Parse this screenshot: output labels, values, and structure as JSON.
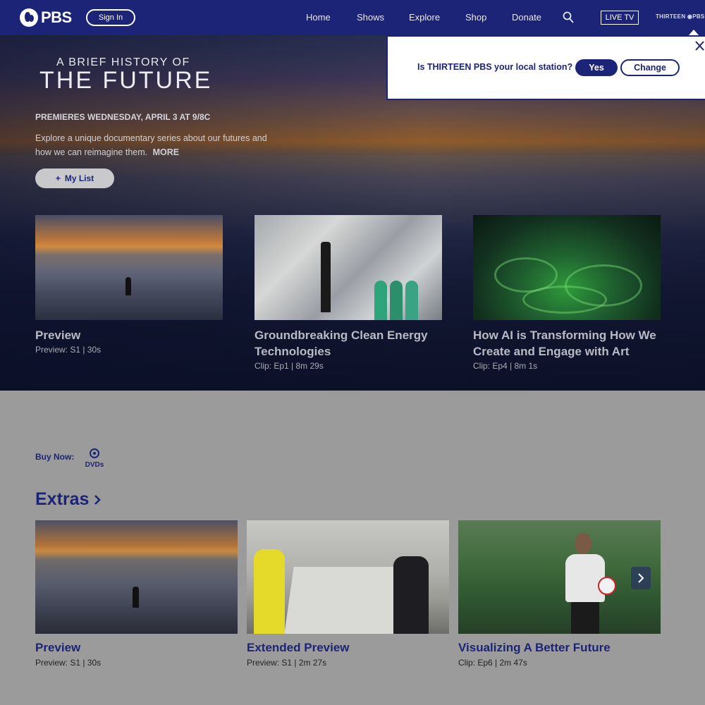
{
  "header": {
    "logo_text": "PBS",
    "signin_label": "Sign In",
    "nav": [
      "Home",
      "Shows",
      "Explore",
      "Shop",
      "Donate"
    ],
    "live_label": "LIVE TV",
    "station_logo_text": "THIRTEEN ◉PBS"
  },
  "hero": {
    "title_line1": "A BRIEF HISTORY OF",
    "title_line2": "THE FUTURE",
    "premiere": "PREMIERES WEDNESDAY, APRIL 3 AT 9/8C",
    "description": "Explore a unique documentary series about our futures and how we can reimagine them.",
    "more_label": "MORE",
    "mylist_label": "My List",
    "cards": [
      {
        "title": "Preview",
        "meta": "Preview: S1 | 30s"
      },
      {
        "title": "Groundbreaking Clean Energy Technologies",
        "meta": "Clip: Ep1 | 8m 29s"
      },
      {
        "title": "How AI is Transforming How We Create and Engage with Art",
        "meta": "Clip: Ep4 | 8m 1s"
      }
    ]
  },
  "buy": {
    "label": "Buy Now:",
    "dvd_label": "DVDs"
  },
  "extras": {
    "heading": "Extras",
    "cards": [
      {
        "title": "Preview",
        "meta": "Preview: S1 | 30s"
      },
      {
        "title": "Extended Preview",
        "meta": "Preview: S1 | 2m 27s"
      },
      {
        "title": "Visualizing A Better Future",
        "meta": "Clip: Ep6 | 2m 47s"
      }
    ]
  },
  "station_modal": {
    "question": "Is THIRTEEN PBS your local station?",
    "yes_label": "Yes",
    "change_label": "Change"
  },
  "colors": {
    "brand_blue": "#1b2477",
    "overlay_gray": "#9b9b9b"
  }
}
